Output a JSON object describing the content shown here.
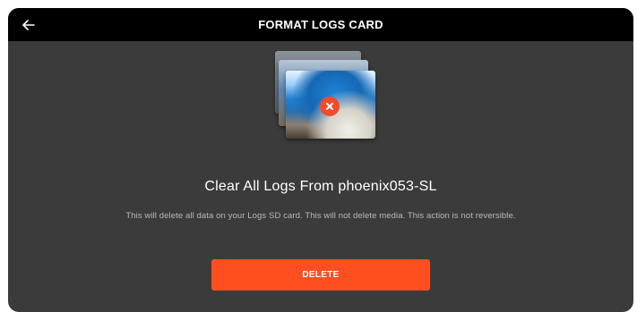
{
  "header": {
    "title": "FORMAT LOGS CARD",
    "back_icon": "arrow-left-icon"
  },
  "illustration": {
    "icon": "photo-stack-icon",
    "badge_icon": "close-icon",
    "badge_color": "#f24a2c"
  },
  "content": {
    "headline": "Clear All Logs From phoenix053-SL",
    "description": "This will delete all data on your Logs SD card. This will not delete media. This action is not reversible."
  },
  "actions": {
    "delete_label": "DELETE",
    "delete_color": "#ff4e1f"
  },
  "colors": {
    "background": "#3b3b3b",
    "header_bg": "#000000"
  }
}
